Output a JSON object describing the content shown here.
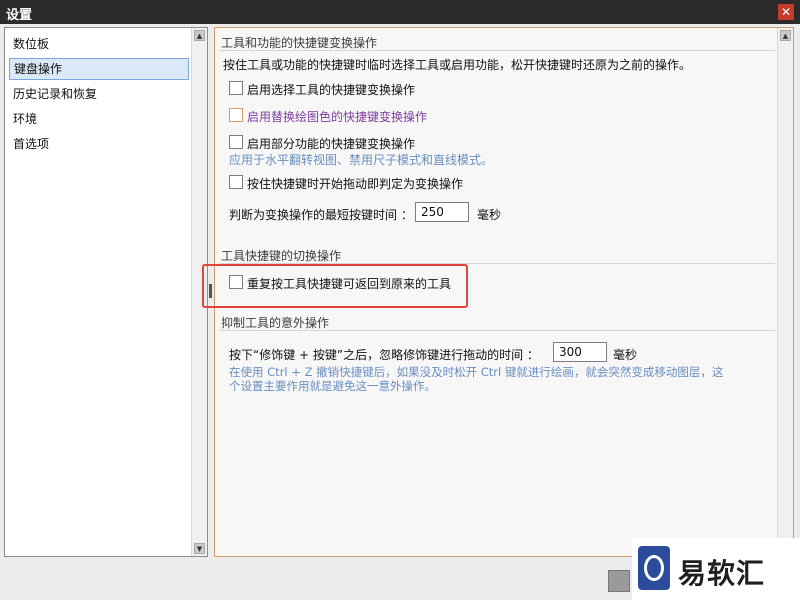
{
  "window": {
    "title": "设置",
    "close_icon": "close-icon"
  },
  "sidebar": {
    "items": [
      {
        "label": "数位板"
      },
      {
        "label": "键盘操作",
        "selected": true
      },
      {
        "label": "历史记录和恢复"
      },
      {
        "label": "环境"
      },
      {
        "label": "首选项"
      }
    ]
  },
  "sections": {
    "s1": {
      "title": "工具和功能的快捷键变换操作",
      "desc": "按住工具或功能的快捷键时临时选择工具或启用功能，松开快捷键时还原为之前的操作。",
      "cb1": "启用选择工具的快捷键变换操作",
      "cb2": "启用替换绘图色的快捷键变换操作",
      "cb3": "启用部分功能的快捷键变换操作",
      "cb3_hint": "应用于水平翻转视图、禁用尺子模式和直线模式。",
      "cb4": "按住快捷键时开始拖动即判定为变换操作",
      "min_time_label": "判断为变换操作的最短按键时间 ：",
      "min_time_value": "250",
      "min_time_unit": "毫秒"
    },
    "s2": {
      "title": "工具快捷键的切换操作",
      "cb1": "重复按工具快捷键可返回到原来的工具"
    },
    "s3": {
      "title": "抑制工具的意外操作",
      "ignore_label": "按下“修饰键 + 按键”之后，忽略修饰键进行拖动的时间 ：",
      "ignore_value": "300",
      "ignore_unit": "毫秒",
      "hint_line1": "在使用 Ctrl + Z 撤销快捷键后，如果没及时松开 Ctrl 键就进行绘画，就会突然变成移动图层，这",
      "hint_line2": "个设置主要作用就是避免这一意外操作。"
    }
  },
  "watermark": {
    "text": "易软汇"
  },
  "colors": {
    "highlight": "#e0443a",
    "hint": "#6a8ec0",
    "accent_border": "#d09a6a"
  }
}
